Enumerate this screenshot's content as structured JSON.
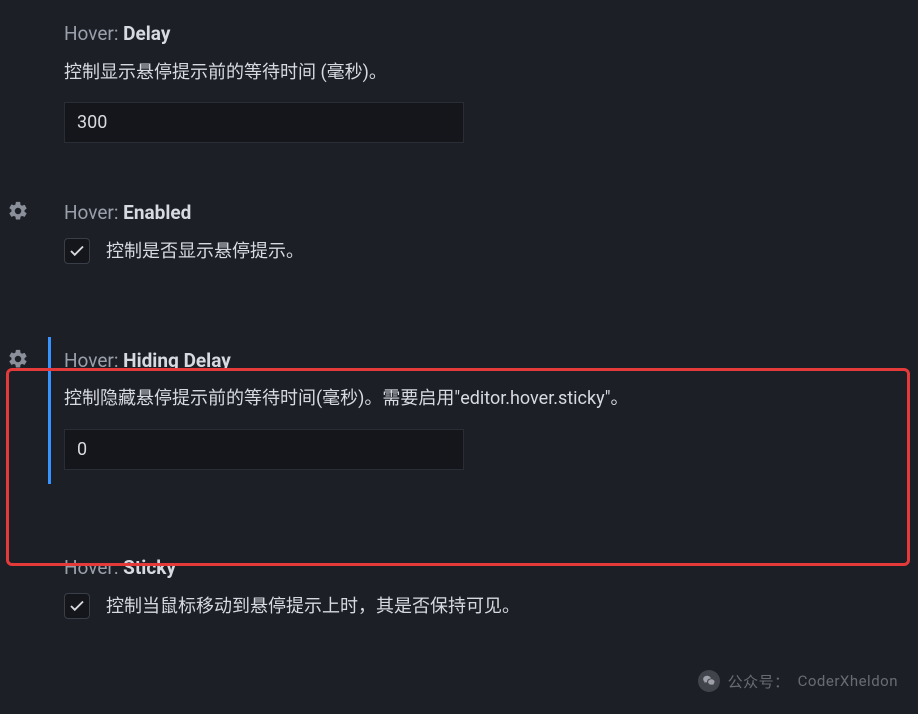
{
  "settings": {
    "delay": {
      "prefix": "Hover: ",
      "name": "Delay",
      "desc": "控制显示悬停提示前的等待时间 (毫秒)。",
      "value": "300"
    },
    "enabled": {
      "prefix": "Hover: ",
      "name": "Enabled",
      "label": "控制是否显示悬停提示。",
      "checked": true
    },
    "hiding": {
      "prefix": "Hover: ",
      "name": "Hiding Delay",
      "desc": "控制隐藏悬停提示前的等待时间(毫秒)。需要启用\"editor.hover.sticky\"。",
      "value": "0"
    },
    "sticky": {
      "prefix": "Hover: ",
      "name": "Sticky",
      "label": "控制当鼠标移动到悬停提示上时，其是否保持可见。",
      "checked": true
    }
  },
  "watermark": {
    "prefix": "公众号：",
    "name": "CoderXheldon"
  }
}
